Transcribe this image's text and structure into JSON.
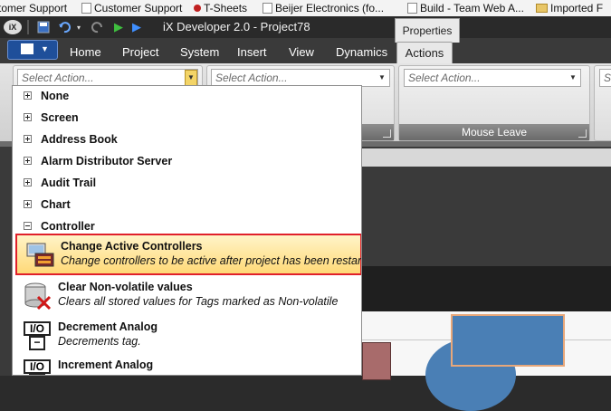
{
  "bookmarks": [
    {
      "label": "tomer Support",
      "icon": "page"
    },
    {
      "label": "Customer Support",
      "icon": "page"
    },
    {
      "label": "T-Sheets",
      "icon": "tsheets"
    },
    {
      "label": "Beijer Electronics (fo...",
      "icon": "page"
    },
    {
      "label": "Build - Team Web A...",
      "icon": "page"
    },
    {
      "label": "Imported F",
      "icon": "folder"
    }
  ],
  "window": {
    "title": "iX Developer 2.0 - Project78",
    "app_badge": "iX"
  },
  "ribbon": {
    "tabs": [
      "Home",
      "Project",
      "System",
      "Insert",
      "View",
      "Dynamics"
    ],
    "active_tab": "Actions",
    "context_group": "Properties",
    "groups": [
      {
        "placeholder": "Select Action...",
        "caption": ""
      },
      {
        "placeholder": "Select Action...",
        "caption": ""
      },
      {
        "placeholder": "Select Action...",
        "caption": "Mouse Leave"
      },
      {
        "placeholder": "S",
        "caption": ""
      }
    ]
  },
  "dropdown": {
    "categories": [
      {
        "label": "None",
        "expanded": false
      },
      {
        "label": "Screen",
        "expanded": false
      },
      {
        "label": "Address Book",
        "expanded": false
      },
      {
        "label": "Alarm Distributor Server",
        "expanded": false
      },
      {
        "label": "Audit Trail",
        "expanded": false
      },
      {
        "label": "Chart",
        "expanded": false
      },
      {
        "label": "Controller",
        "expanded": true
      }
    ],
    "items": [
      {
        "title": "Change Active Controllers",
        "desc": "Change controllers to be active after project has been restarted.",
        "icon": "controllers-icon",
        "selected": true
      },
      {
        "title": "Clear Non-volatile values",
        "desc": "Clears all stored values for Tags marked as Non-volatile",
        "icon": "database-clear-icon",
        "selected": false
      },
      {
        "title": "Decrement Analog",
        "desc": "Decrements tag.",
        "icon": "io-decrement-icon",
        "selected": false
      },
      {
        "title": "Increment Analog",
        "desc": "",
        "icon": "io-increment-icon",
        "selected": false
      }
    ]
  },
  "colors": {
    "selection_border": "#e0202a",
    "selection_fill": "#ffd977",
    "ribbon_dark": "#3a3a3a",
    "shape_blue": "#4a7fb5"
  }
}
